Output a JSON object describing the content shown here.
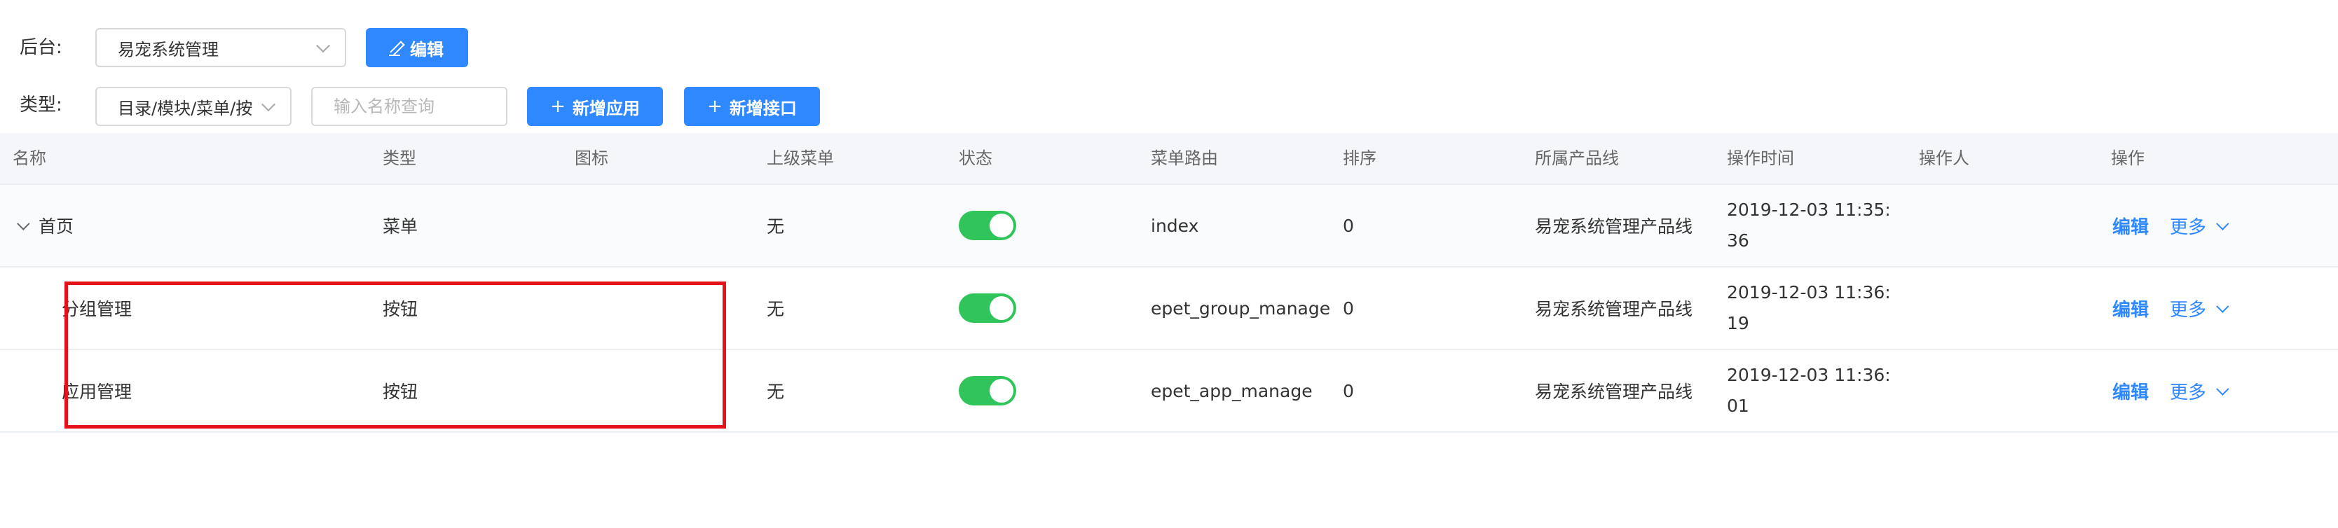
{
  "filters": {
    "backend_label": "后台:",
    "backend_value": "易宠系统管理",
    "edit_label": "编辑",
    "type_label": "类型:",
    "type_value": "目录/模块/菜单/按",
    "search_placeholder": "输入名称查询",
    "add_app_label": "新增应用",
    "add_api_label": "新增接口"
  },
  "table": {
    "headers": {
      "name": "名称",
      "type": "类型",
      "icon": "图标",
      "parent": "上级菜单",
      "status": "状态",
      "route": "菜单路由",
      "order": "排序",
      "product_line": "所属产品线",
      "op_time": "操作时间",
      "operator": "操作人",
      "actions": "操作"
    },
    "rows": [
      {
        "name": "首页",
        "type": "菜单",
        "icon": "",
        "parent": "无",
        "status": true,
        "route": "index",
        "order": "0",
        "product_line": "易宠系统管理产品线",
        "op_time": "2019-12-03 11:35:36",
        "operator": "",
        "edit": "编辑",
        "more": "更多"
      },
      {
        "name": "分组管理",
        "type": "按钮",
        "icon": "",
        "parent": "无",
        "status": true,
        "route": "epet_group_manage",
        "order": "0",
        "product_line": "易宠系统管理产品线",
        "op_time": "2019-12-03 11:36:19",
        "operator": "",
        "edit": "编辑",
        "more": "更多"
      },
      {
        "name": "应用管理",
        "type": "按钮",
        "icon": "",
        "parent": "无",
        "status": true,
        "route": "epet_app_manage",
        "order": "0",
        "product_line": "易宠系统管理产品线",
        "op_time": "2019-12-03 11:36:01",
        "operator": "",
        "edit": "编辑",
        "more": "更多"
      }
    ]
  },
  "colors": {
    "accent": "#2f88ff",
    "toggle_on": "#30c45a",
    "highlight": "#e3121b"
  }
}
